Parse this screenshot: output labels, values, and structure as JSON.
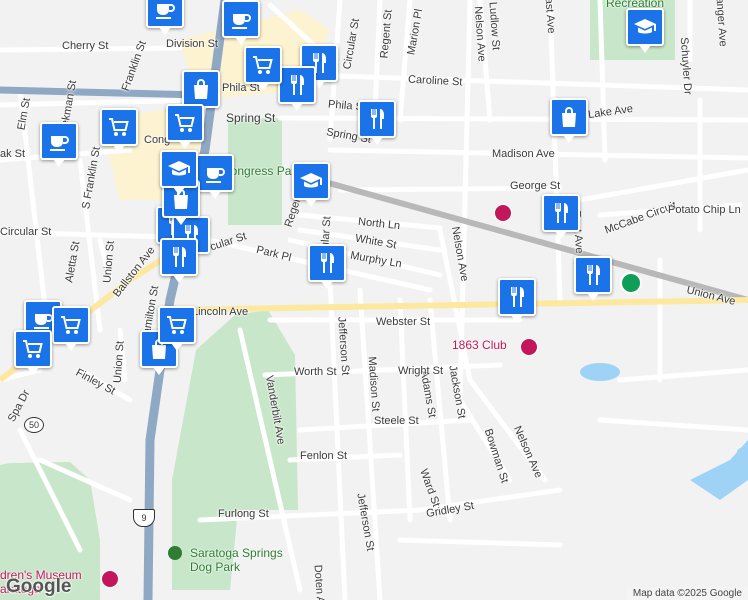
{
  "streets": {
    "cherry": "Cherry St",
    "franklin": "Franklin St",
    "division": "Division St",
    "circular_top": "Circular St",
    "regent_top": "Regent St",
    "marion": "Marion Pl",
    "nelson_top": "Nelson Ave",
    "ludlow": "Ludlow St",
    "east_ave": "East Ave",
    "granger": "Granger Ave",
    "schuyler": "Schuyler Dr",
    "caroline": "Caroline St",
    "phila_left": "Phila St",
    "phila_right": "Phila St",
    "lake": "Lake Ave",
    "spring_left": "Spring St",
    "spring_right": "Spring St",
    "congress": "Congress St",
    "elm": "Elm St",
    "beekman": "Beekman St",
    "oak": "Oak St",
    "s_franklin": "S Franklin St",
    "madison_ave": "Madison Ave",
    "george": "George St",
    "north_ln": "North Ln",
    "white": "White St",
    "murphy": "Murphy Ln",
    "mccabe": "McCabe Circuit",
    "potato": "Potato Chip Ln",
    "east_ave_mid": "East Ave",
    "nelson_mid": "Nelson Ave",
    "regent_mid": "Regent St",
    "circular_mid": "Circular St",
    "circular_left": "Circular St",
    "park_pl": "Park Pl",
    "aletta": "Aletta St",
    "union_st_top": "Union St",
    "ballston": "Ballston Ave",
    "hamilton": "Hamilton St",
    "lincoln": "Lincoln Ave",
    "union_ave": "Union Ave",
    "webster": "Webster St",
    "jefferson_top": "Jefferson St",
    "madison_st": "Madison St",
    "adams": "Adams St",
    "jackson": "Jackson St",
    "union_st_low": "Union St",
    "finley": "Finley St",
    "spa_dr": "Spa Dr",
    "worth": "Worth St",
    "wright": "Wright St",
    "vanderbilt": "Vanderbilt Ave",
    "steele": "Steele St",
    "fenlon": "Fenlon St",
    "ward": "Ward St",
    "bowman": "Bowman St",
    "nelson_low": "Nelson Ave",
    "gridley": "Gridley St",
    "furlong": "Furlong St",
    "jefferson_low": "Jefferson St",
    "doten": "Doten Ave",
    "oak_cut": "ak St",
    "cong_cut": "Cong",
    "regent_cut": "Regent",
    "rec_cut": "Recreation"
  },
  "places": {
    "congress_park": "Congress Park",
    "club_1863": "1863 Club",
    "dog_park_line1": "Saratoga Springs",
    "dog_park_line2": "Dog Park",
    "museum_line1": "dren's Museum",
    "museum_line2": "aratoga"
  },
  "shields": {
    "route_50": "50",
    "route_9": "9"
  },
  "markers": [
    {
      "type": "cafe",
      "icon": "coffee-cup-icon"
    },
    {
      "type": "cafe",
      "icon": "coffee-cup-icon"
    },
    {
      "type": "cafe",
      "icon": "coffee-cup-icon"
    },
    {
      "type": "cafe",
      "icon": "coffee-cup-icon"
    },
    {
      "type": "cafe",
      "icon": "coffee-cup-icon"
    },
    {
      "type": "restaurant",
      "icon": "fork-knife-icon"
    },
    {
      "type": "restaurant",
      "icon": "fork-knife-icon"
    },
    {
      "type": "restaurant",
      "icon": "fork-knife-icon"
    },
    {
      "type": "restaurant",
      "icon": "fork-knife-icon"
    },
    {
      "type": "restaurant",
      "icon": "fork-knife-icon"
    },
    {
      "type": "restaurant",
      "icon": "fork-knife-icon"
    },
    {
      "type": "restaurant",
      "icon": "fork-knife-icon"
    },
    {
      "type": "restaurant",
      "icon": "fork-knife-icon"
    },
    {
      "type": "restaurant",
      "icon": "fork-knife-icon"
    },
    {
      "type": "restaurant",
      "icon": "fork-knife-icon"
    },
    {
      "type": "shopping",
      "icon": "shopping-bag-icon"
    },
    {
      "type": "shopping",
      "icon": "shopping-bag-icon"
    },
    {
      "type": "shopping",
      "icon": "shopping-bag-icon"
    },
    {
      "type": "shopping",
      "icon": "shopping-bag-icon"
    },
    {
      "type": "grocery",
      "icon": "shopping-cart-icon"
    },
    {
      "type": "grocery",
      "icon": "shopping-cart-icon"
    },
    {
      "type": "grocery",
      "icon": "shopping-cart-icon"
    },
    {
      "type": "grocery",
      "icon": "shopping-cart-icon"
    },
    {
      "type": "grocery",
      "icon": "shopping-cart-icon"
    },
    {
      "type": "grocery",
      "icon": "shopping-cart-icon"
    },
    {
      "type": "school",
      "icon": "graduation-cap-icon"
    },
    {
      "type": "school",
      "icon": "graduation-cap-icon"
    },
    {
      "type": "school",
      "icon": "graduation-cap-icon"
    }
  ],
  "footer": {
    "logo": "Google",
    "attribution": "Map data ©2025 Google"
  },
  "colors": {
    "marker": "#1a73e8",
    "park": "#c8e6c9",
    "water": "#9fd3f5",
    "highway": "#8fa8c4",
    "poi": "#c2185b"
  }
}
